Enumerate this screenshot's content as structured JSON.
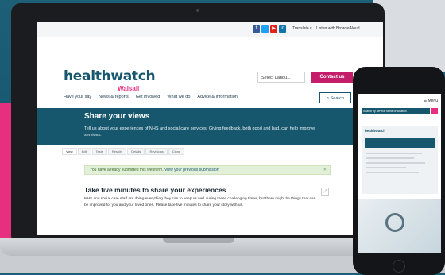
{
  "colors": {
    "teal": "#17576e",
    "pink": "#e6307f",
    "contact": "#c41e6a",
    "notice_bg": "#e3f0d9"
  },
  "util": {
    "translate": "Translate ▾",
    "listen": "Listen with BrowseAloud",
    "social": [
      "f",
      "t",
      "▶",
      "in"
    ]
  },
  "header": {
    "logo": "healthwatch",
    "logo_sub": "Walsall",
    "language": "Select Langu...",
    "contact": "Contact us",
    "search": "Search"
  },
  "nav": [
    "Have your say",
    "News & reports",
    "Get involved",
    "What we do",
    "Advice & information"
  ],
  "hero": {
    "title": "Share your views",
    "desc": "Tell us about your experiences of NHS and social care services. Giving feedback, both good and bad, can help improve services."
  },
  "tabs": [
    "View",
    "Edit",
    "Tests",
    "Results",
    "Details",
    "Revisions",
    "Clone"
  ],
  "notice": {
    "text": "You have already submitted this webform. ",
    "link": "View your previous submission"
  },
  "content": {
    "title": "Take five minutes to share your experiences",
    "body": "NHS and social care staff are doing everything they can to keep us well during these challenging times, but there might be things that can be improved for you and your loved ones. Please take five minutes to share your story with us."
  },
  "phone": {
    "menu": "☰ Menu",
    "search_placeholder": "Search by service name or location"
  }
}
